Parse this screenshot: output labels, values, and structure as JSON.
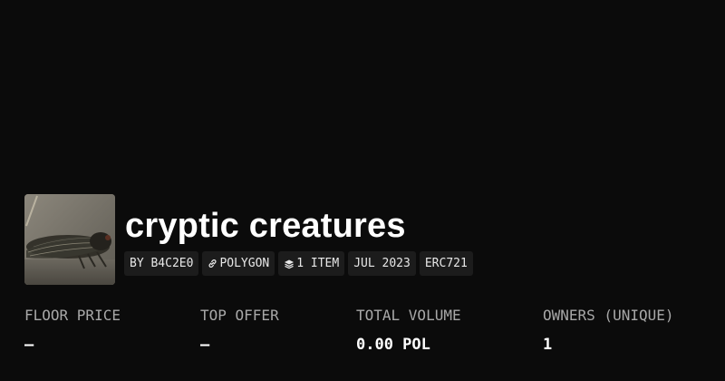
{
  "collection": {
    "title": "cryptic creatures",
    "image_alt": "cicada-photo"
  },
  "tags": {
    "creator": "BY B4C2E0",
    "chain": "POLYGON",
    "items": "1 ITEM",
    "date": "JUL 2023",
    "standard": "ERC721"
  },
  "stats": {
    "floor_price": {
      "label": "FLOOR PRICE",
      "value": "—"
    },
    "top_offer": {
      "label": "TOP OFFER",
      "value": "—"
    },
    "total_volume": {
      "label": "TOTAL VOLUME",
      "value": "0.00 POL"
    },
    "owners": {
      "label": "OWNERS (UNIQUE)",
      "value": "1"
    }
  },
  "colors": {
    "background": "#0b0b0b",
    "tag_background": "#1c1c1c",
    "label_gray": "#a8a8a8",
    "text": "#ffffff"
  },
  "icons": {
    "chain": "link-icon",
    "items": "layers-icon"
  }
}
